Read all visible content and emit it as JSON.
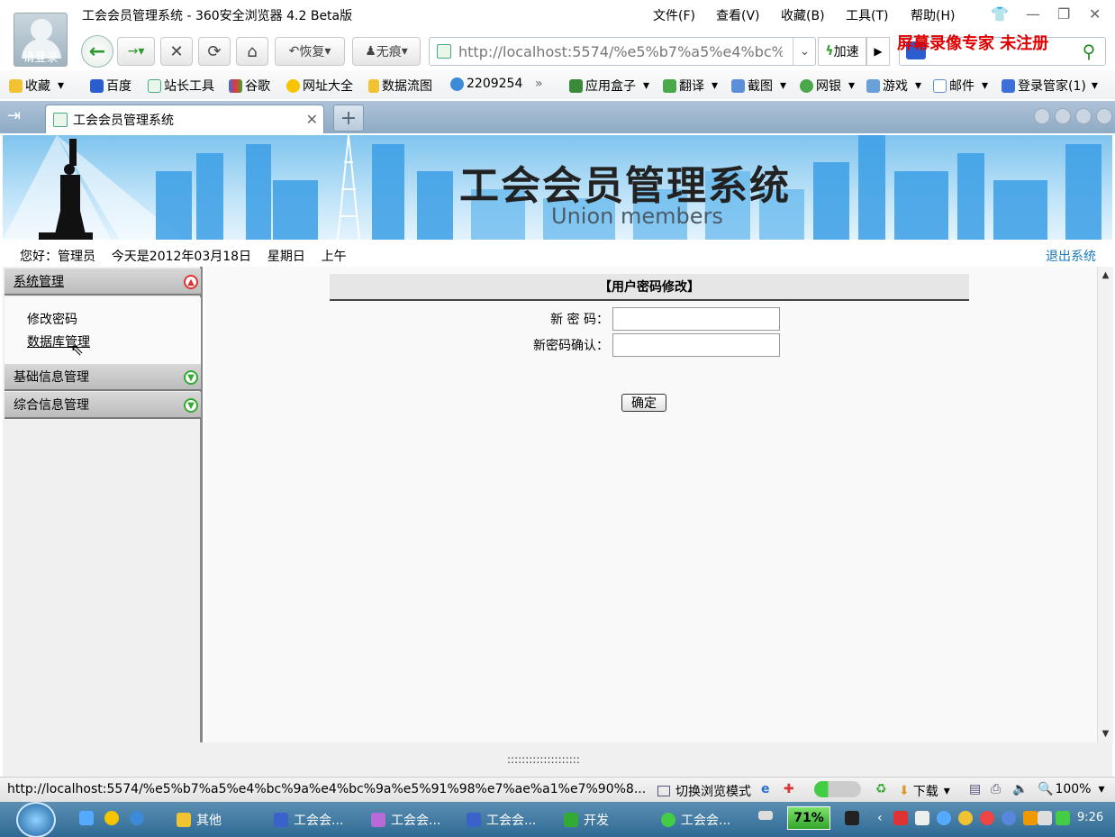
{
  "window": {
    "title": "工会会员管理系统 - 360安全浏览器 4.2 Beta版",
    "avatar_label": "请登录",
    "menus": [
      "文件(F)",
      "查看(V)",
      "收藏(B)",
      "工具(T)",
      "帮助(H)"
    ]
  },
  "toolbar": {
    "restore_label": "恢复",
    "incognito_label": "无痕",
    "address": "http://localhost:5574/%e5%b7%a5%e4%bc%",
    "speed_label": "加速",
    "watermark": "屏幕录像专家  未注册"
  },
  "bookmarks": [
    "收藏",
    "百度",
    "站长工具",
    "谷歌",
    "网址大全",
    "数据流图",
    "2209254",
    "应用盒子",
    "翻译",
    "截图",
    "网银",
    "游戏",
    "邮件",
    "登录管家(1)"
  ],
  "tab": {
    "title": "工会会员管理系统"
  },
  "banner": {
    "title": "工会会员管理系统",
    "subtitle": "Union members"
  },
  "infoline": {
    "greeting": "您好：管理员    今天是2012年03月18日    星期日    上午",
    "logout": "退出系统"
  },
  "sidebar": {
    "sections": [
      {
        "label": "系统管理",
        "items": [
          "修改密码",
          "数据库管理"
        ]
      },
      {
        "label": "基础信息管理"
      },
      {
        "label": "综合信息管理"
      }
    ]
  },
  "form": {
    "title": "【用户密码修改】",
    "new_password_label": "新 密 码：",
    "confirm_label": "新密码确认：",
    "new_password_value": "",
    "confirm_value": "",
    "submit_label": "确定"
  },
  "divider": {
    "dots": "::::::::::::::::::::"
  },
  "statusbar": {
    "url": "http://localhost:5574/%e5%b7%a5%e4%bc%9a%e4%bc%9a%e5%91%98%e7%ae%a1%e7%90%8...",
    "mode": "切换浏览模式",
    "download": "下载",
    "zoom": "100%"
  },
  "taskbar": {
    "items": [
      "其他",
      "工会会...",
      "工会会...",
      "工会会...",
      "开发",
      "工会会..."
    ],
    "battery": "71%",
    "clock": "9:26"
  },
  "colors": {
    "logout_link": "#1a7ab8",
    "watermark": "#e00000",
    "banner_sky": "#7fc4ee"
  }
}
